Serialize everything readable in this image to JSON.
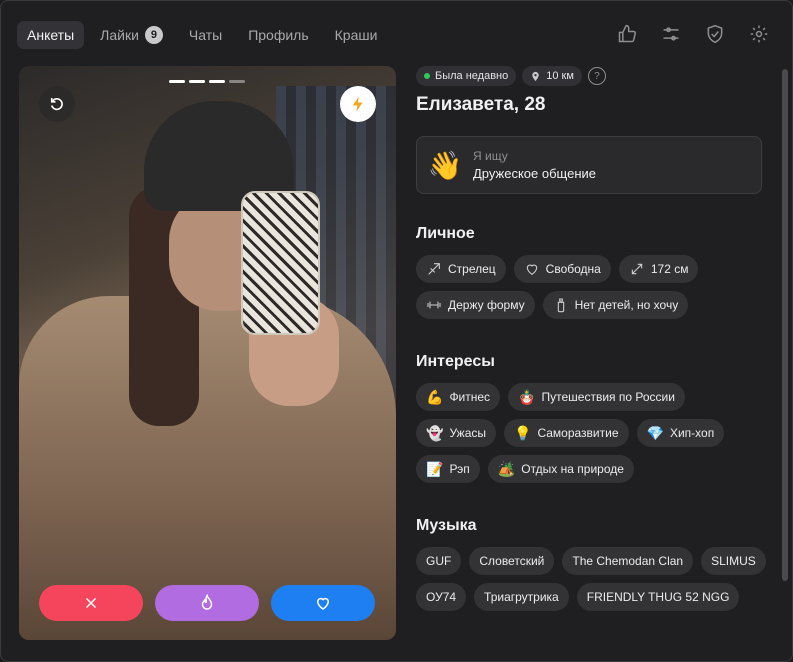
{
  "nav": {
    "tabs": [
      {
        "label": "Анкеты",
        "active": true
      },
      {
        "label": "Лайки",
        "badge": "9"
      },
      {
        "label": "Чаты"
      },
      {
        "label": "Профиль"
      },
      {
        "label": "Краши"
      }
    ],
    "icons": [
      "thumbs-up-icon",
      "filters-icon",
      "shield-icon",
      "settings-icon"
    ]
  },
  "photo": {
    "page_count": 4,
    "current_page": 3
  },
  "profile": {
    "status": "Была недавно",
    "distance": "10 км",
    "name_age": "Елизавета, 28",
    "seeking": {
      "label": "Я ищу",
      "value": "Дружеское общение",
      "emoji": "👋"
    }
  },
  "sections": {
    "personal": {
      "title": "Личное",
      "items": [
        {
          "icon": "zodiac-arrow-icon",
          "label": "Стрелец"
        },
        {
          "icon": "heart-outline-icon",
          "label": "Свободна"
        },
        {
          "icon": "height-arrows-icon",
          "label": "172 см"
        },
        {
          "icon": "dumbbell-icon",
          "label": "Держу форму"
        },
        {
          "icon": "baby-bottle-icon",
          "label": "Нет детей, но хочу"
        }
      ]
    },
    "interests": {
      "title": "Интересы",
      "items": [
        {
          "emoji": "💪",
          "label": "Фитнес"
        },
        {
          "emoji": "🪆",
          "label": "Путешествия по России"
        },
        {
          "emoji": "👻",
          "label": "Ужасы"
        },
        {
          "emoji": "💡",
          "label": "Саморазвитие"
        },
        {
          "emoji": "💎",
          "label": "Хип-хоп"
        },
        {
          "emoji": "📝",
          "label": "Рэп"
        },
        {
          "emoji": "🏕️",
          "label": "Отдых на природе"
        }
      ]
    },
    "music": {
      "title": "Музыка",
      "items": [
        {
          "label": "GUF"
        },
        {
          "label": "Словетский"
        },
        {
          "label": "The Chemodan Clan"
        },
        {
          "label": "SLIMUS"
        },
        {
          "label": "ОУ74"
        },
        {
          "label": "Триагрутрика"
        },
        {
          "label": "FRIENDLY THUG 52 NGG"
        }
      ]
    }
  },
  "colors": {
    "dislike": "#f5455c",
    "superlike": "#b06ce0",
    "like": "#1e7ff2",
    "online": "#32c759"
  }
}
